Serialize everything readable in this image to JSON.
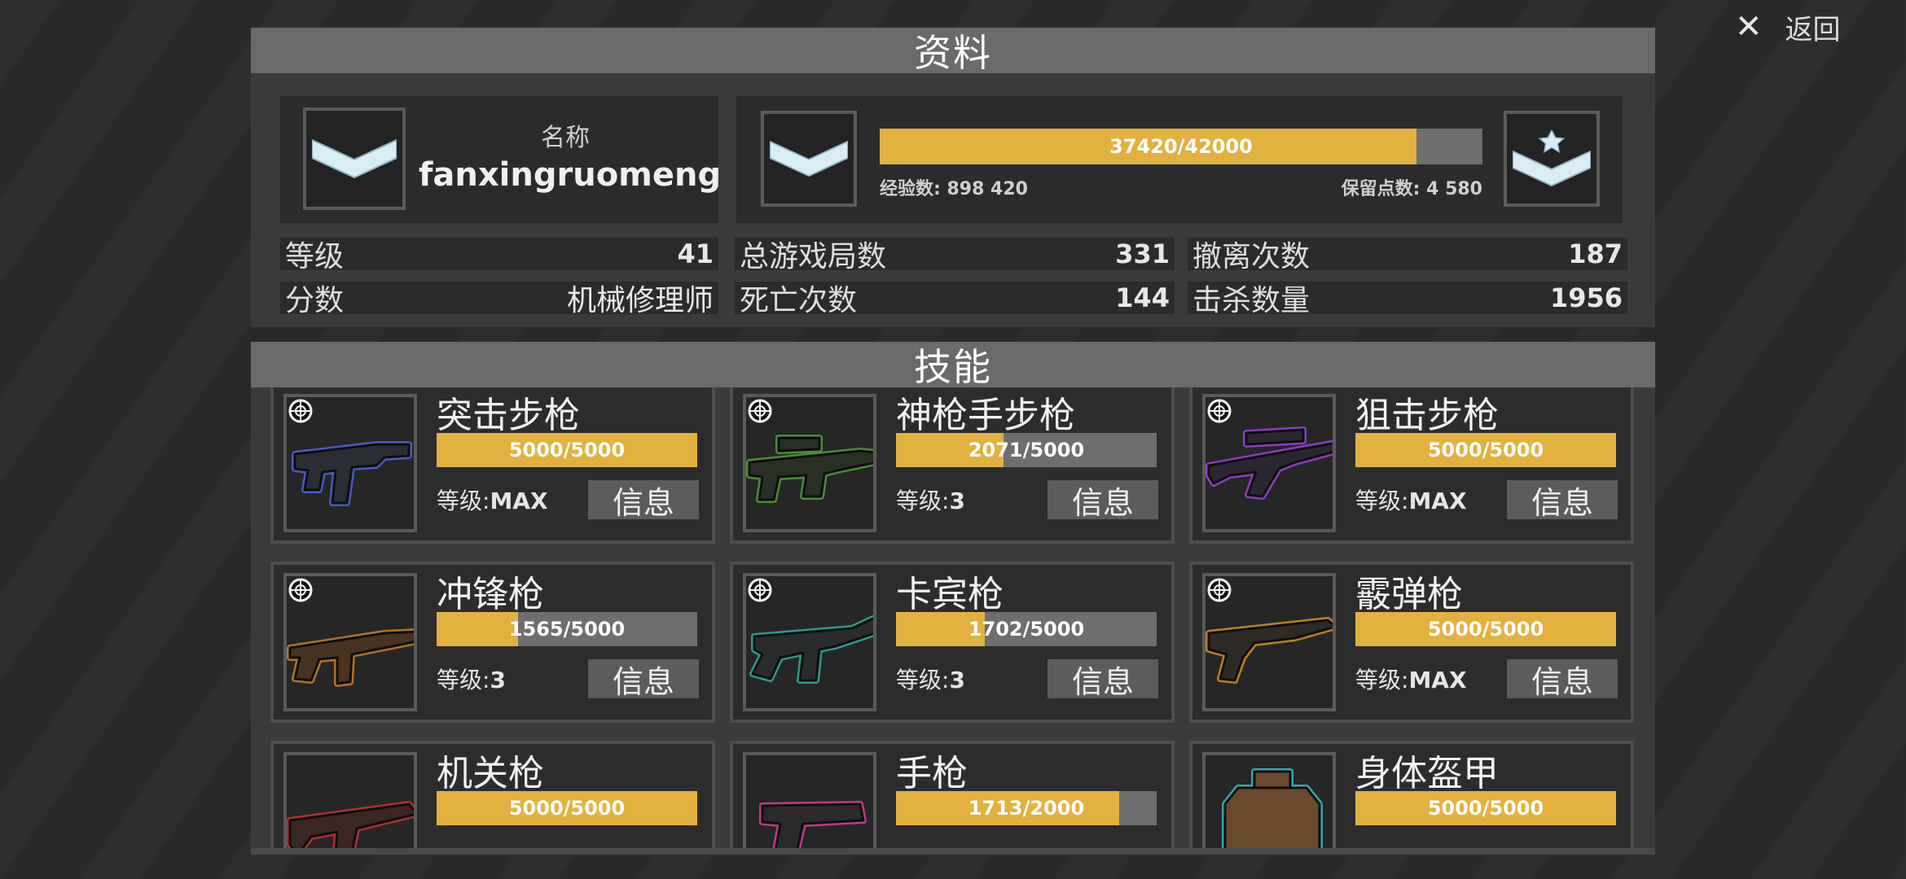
{
  "nav": {
    "close_label": "返回"
  },
  "profile": {
    "header": "资料",
    "name_label": "名称",
    "name": "fanxingruomeng",
    "xp": {
      "current": 37420,
      "max": 42000,
      "text": "37420/42000",
      "exp_text": "经验数: 898 420",
      "reserve_text": "保留点数: 4 580"
    },
    "stats": [
      {
        "label": "等级",
        "value": "41"
      },
      {
        "label": "总游戏局数",
        "value": "331"
      },
      {
        "label": "撤离次数",
        "value": "187"
      },
      {
        "label": "分数",
        "value": "机械修理师"
      },
      {
        "label": "死亡次数",
        "value": "144"
      },
      {
        "label": "击杀数量",
        "value": "1956"
      }
    ]
  },
  "skills": {
    "header": "技能",
    "info_label": "信息",
    "level_prefix": "等级:",
    "items": [
      {
        "name": "突击步枪",
        "progress": "5000/5000",
        "fraction": 1.0,
        "level": "MAX",
        "glow": "#4a63d8",
        "icon": "assault-rifle-icon"
      },
      {
        "name": "神枪手步枪",
        "progress": "2071/5000",
        "fraction": 0.414,
        "level": "3",
        "glow": "#4e9a3a",
        "icon": "marksman-rifle-icon"
      },
      {
        "name": "狙击步枪",
        "progress": "5000/5000",
        "fraction": 1.0,
        "level": "MAX",
        "glow": "#9b3fd6",
        "icon": "sniper-rifle-icon"
      },
      {
        "name": "冲锋枪",
        "progress": "1565/5000",
        "fraction": 0.313,
        "level": "3",
        "glow": "#c87a2a",
        "icon": "submachine-gun-icon"
      },
      {
        "name": "卡宾枪",
        "progress": "1702/5000",
        "fraction": 0.34,
        "level": "3",
        "glow": "#2fa89a",
        "icon": "carbine-icon"
      },
      {
        "name": "霰弹枪",
        "progress": "5000/5000",
        "fraction": 1.0,
        "level": "MAX",
        "glow": "#d08a20",
        "icon": "shotgun-icon"
      },
      {
        "name": "机关枪",
        "progress": "5000/5000",
        "fraction": 1.0,
        "level": "",
        "glow": "#c8302c",
        "icon": "machine-gun-icon"
      },
      {
        "name": "手枪",
        "progress": "1713/2000",
        "fraction": 0.8565,
        "level": "",
        "glow": "#d43a9a",
        "icon": "pistol-icon"
      },
      {
        "name": "身体盔甲",
        "progress": "5000/5000",
        "fraction": 1.0,
        "level": "",
        "glow": "#39b6c0",
        "icon": "body-armor-icon"
      }
    ]
  }
}
